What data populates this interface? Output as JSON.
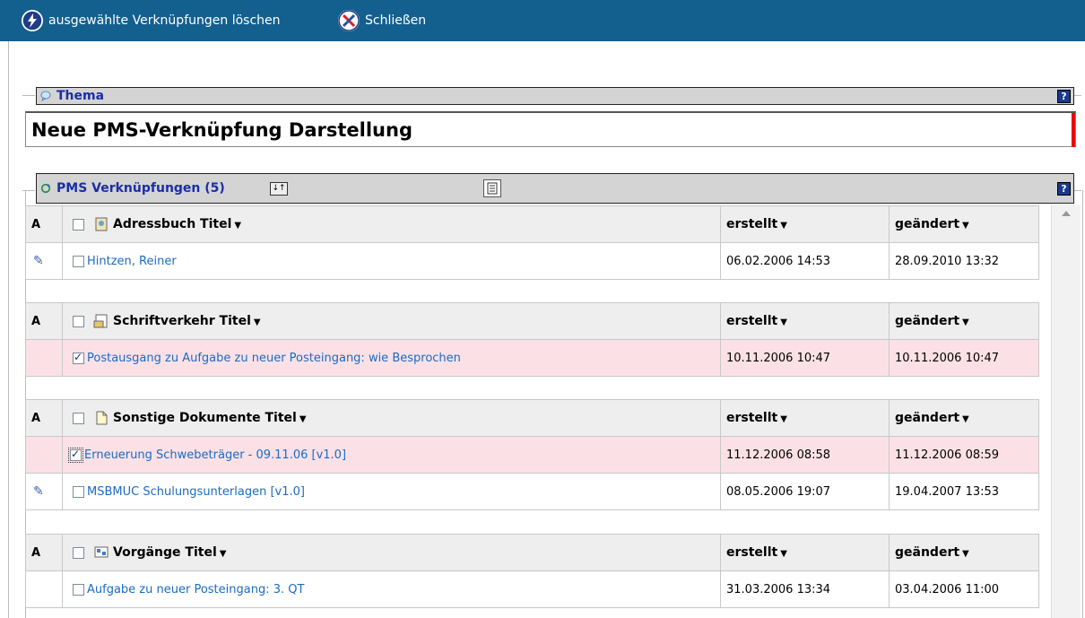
{
  "toolbar": {
    "delete_label": "ausgewählte Verknüpfungen löschen",
    "close_label": "Schließen"
  },
  "thema": {
    "section_label": "Thema",
    "value": "Neue PMS-Verknüpfung Darstellung"
  },
  "pms": {
    "section_label": "PMS Verknüpfungen (5)",
    "help": "?",
    "column_a": "A",
    "col_created": "erstellt",
    "col_changed": "geändert",
    "groups": [
      {
        "title": "Adressbuch Titel",
        "rows": [
          {
            "link": "Hintzen, Reiner",
            "created": "06.02.2006 14:53",
            "changed": "28.09.2010 13:32",
            "checked": false,
            "attachment": true
          }
        ]
      },
      {
        "title": "Schriftverkehr Titel",
        "rows": [
          {
            "link": "Postausgang zu Aufgabe zu neuer Posteingang: wie Besprochen",
            "created": "10.11.2006 10:47",
            "changed": "10.11.2006 10:47",
            "checked": true,
            "attachment": false
          }
        ]
      },
      {
        "title": "Sonstige Dokumente Titel",
        "rows": [
          {
            "link": "Erneuerung Schwebeträger - 09.11.06 [v1.0]",
            "created": "11.12.2006 08:58",
            "changed": "11.12.2006 08:59",
            "checked": true,
            "attachment": false
          },
          {
            "link": "MSBMUC Schulungsunterlagen [v1.0]",
            "created": "08.05.2006 19:07",
            "changed": "19.04.2007 13:53",
            "checked": false,
            "attachment": true
          }
        ]
      },
      {
        "title": "Vorgänge Titel",
        "rows": [
          {
            "link": "Aufgabe zu neuer Posteingang: 3. QT",
            "created": "31.03.2006 13:34",
            "changed": "03.04.2006 11:00",
            "checked": false,
            "attachment": false
          }
        ]
      }
    ]
  },
  "colors": {
    "toolbar_bg": "#135f8e",
    "selected_row": "#fbe1e6",
    "link": "#1a6bc4",
    "section_title": "#1a2ea8"
  }
}
